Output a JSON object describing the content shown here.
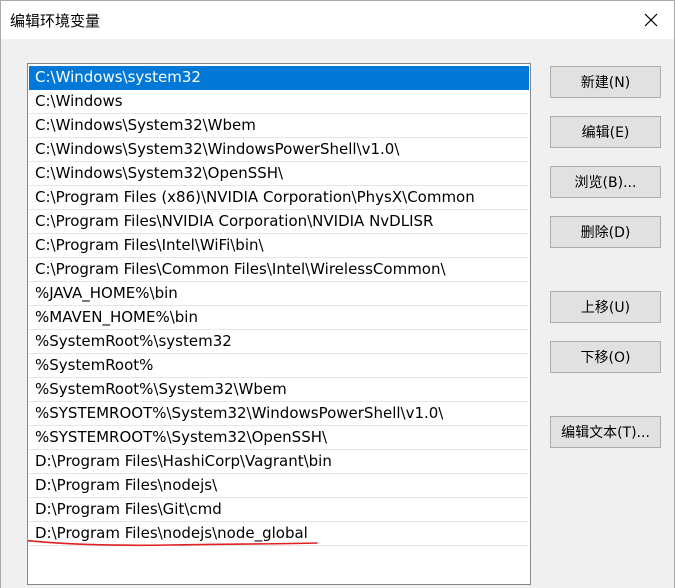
{
  "window": {
    "title": "编辑环境变量"
  },
  "icons": {
    "close": "close-icon"
  },
  "accent_color": "#0078d7",
  "annotation_color": "#e02020",
  "path_list": {
    "selected_index": 0,
    "items": [
      "C:\\Windows\\system32",
      "C:\\Windows",
      "C:\\Windows\\System32\\Wbem",
      "C:\\Windows\\System32\\WindowsPowerShell\\v1.0\\",
      "C:\\Windows\\System32\\OpenSSH\\",
      "C:\\Program Files (x86)\\NVIDIA Corporation\\PhysX\\Common",
      "C:\\Program Files\\NVIDIA Corporation\\NVIDIA NvDLISR",
      "C:\\Program Files\\Intel\\WiFi\\bin\\",
      "C:\\Program Files\\Common Files\\Intel\\WirelessCommon\\",
      "%JAVA_HOME%\\bin",
      "%MAVEN_HOME%\\bin",
      "%SystemRoot%\\system32",
      "%SystemRoot%",
      "%SystemRoot%\\System32\\Wbem",
      "%SYSTEMROOT%\\System32\\WindowsPowerShell\\v1.0\\",
      "%SYSTEMROOT%\\System32\\OpenSSH\\",
      "D:\\Program Files\\HashiCorp\\Vagrant\\bin",
      "D:\\Program Files\\nodejs\\",
      "D:\\Program Files\\Git\\cmd",
      "D:\\Program Files\\nodejs\\node_global"
    ]
  },
  "buttons": {
    "new": "新建(N)",
    "edit": "编辑(E)",
    "browse": "浏览(B)...",
    "delete": "删除(D)",
    "move_up": "上移(U)",
    "move_down": "下移(O)",
    "edit_text": "编辑文本(T)..."
  }
}
